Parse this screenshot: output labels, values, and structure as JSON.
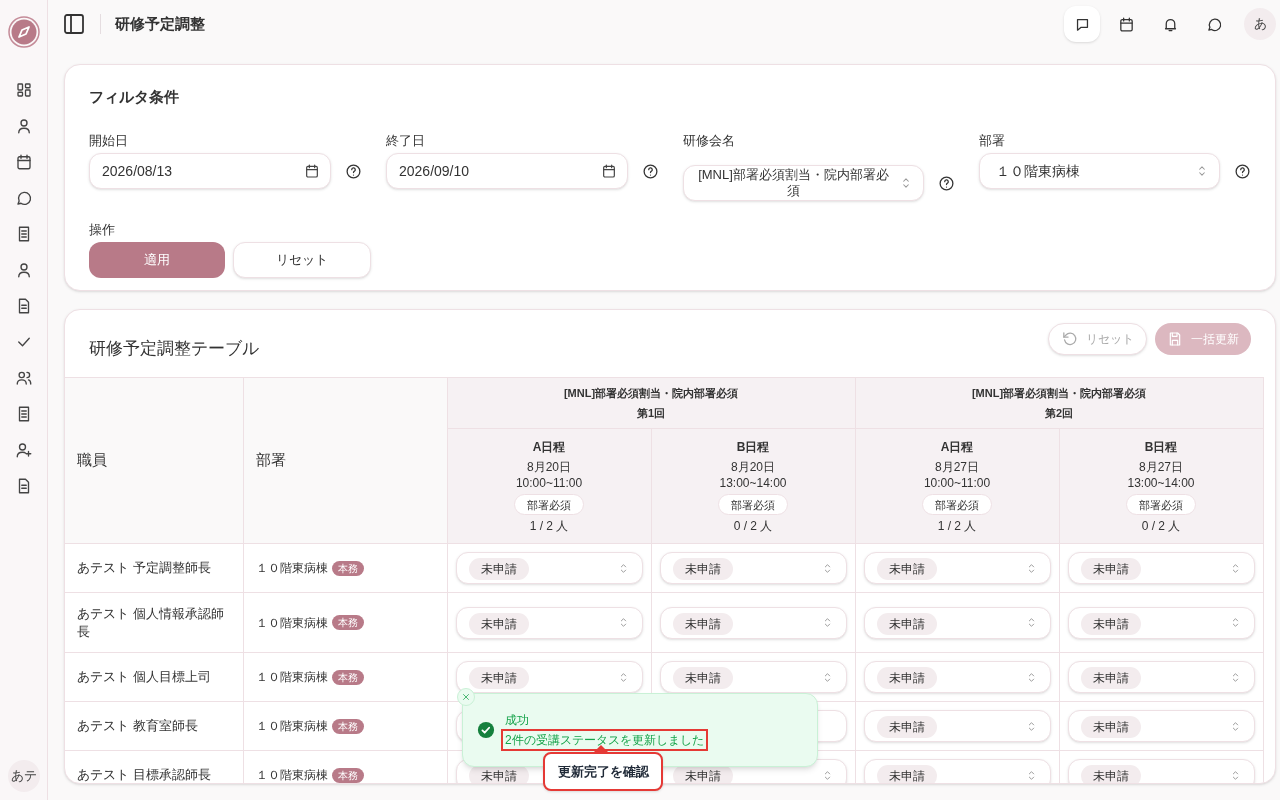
{
  "header": {
    "title": "研修予定調整",
    "avatar": "あ"
  },
  "sidebar": {
    "avatar": "あテ"
  },
  "filter": {
    "title": "フィルタ条件",
    "fields": [
      {
        "kind": "date",
        "label": "開始日",
        "value": "2026/08/13"
      },
      {
        "kind": "date",
        "label": "終了日",
        "value": "2026/09/10"
      },
      {
        "kind": "select",
        "label": "研修会名",
        "value": "[MNL]部署必須割当・院内部署必須"
      },
      {
        "kind": "select",
        "label": "部署",
        "value": "１０階東病棟"
      }
    ],
    "actions_label": "操作",
    "buttons": [
      {
        "kind": "primary",
        "label": "適用"
      },
      {
        "kind": "secondary",
        "label": "リセット"
      }
    ]
  },
  "schedule": {
    "title": "研修予定調整テーブル",
    "buttons": [
      {
        "kind": "reset",
        "label": "リセット",
        "disabled": true
      },
      {
        "kind": "save",
        "label": "一括更新",
        "disabled": true
      }
    ],
    "columns": [
      "職員",
      "部署"
    ],
    "sessions": [
      {
        "name": "[MNL]部署必須割当・院内部署必須",
        "round": "第1回",
        "slots": [
          {
            "label": "A日程",
            "date": "8月20日",
            "time": "10:00~11:00",
            "tag": "部署必須",
            "count": "1 / 2 人"
          },
          {
            "label": "B日程",
            "date": "8月20日",
            "time": "13:00~14:00",
            "tag": "部署必須",
            "count": "0 / 2 人"
          }
        ]
      },
      {
        "name": "[MNL]部署必須割当・院内部署必須",
        "round": "第2回",
        "slots": [
          {
            "label": "A日程",
            "date": "8月27日",
            "time": "10:00~11:00",
            "tag": "部署必須",
            "count": "1 / 2 人"
          },
          {
            "label": "B日程",
            "date": "8月27日",
            "time": "13:00~14:00",
            "tag": "部署必須",
            "count": "0 / 2 人"
          }
        ]
      }
    ],
    "rows": [
      {
        "name": "あテスト 予定調整師長",
        "dept": "１０階東病棟",
        "badge": "本務",
        "statuses": [
          "未申請",
          "未申請",
          "未申請",
          "未申請"
        ]
      },
      {
        "name": "あテスト 個人情報承認師長",
        "dept": "１０階東病棟",
        "badge": "本務",
        "statuses": [
          "未申請",
          "未申請",
          "未申請",
          "未申請"
        ]
      },
      {
        "name": "あテスト 個人目標上司",
        "dept": "１０階東病棟",
        "badge": "本務",
        "statuses": [
          "未申請",
          "未申請",
          "未申請",
          "未申請"
        ]
      },
      {
        "name": "あテスト 教育室師長",
        "dept": "１０階東病棟",
        "badge": "本務",
        "statuses": [
          {
            "kind": "covered"
          },
          {
            "kind": "covered"
          },
          "未申請",
          "未申請"
        ]
      },
      {
        "name": "あテスト 目標承認師長",
        "dept": "１０階東病棟",
        "badge": "本務",
        "statuses": [
          {
            "kind": "partly_covered",
            "status": "未申請"
          },
          "未申請",
          "未申請",
          "未申請"
        ]
      }
    ]
  },
  "toast": {
    "title": "成功",
    "message": "2件の受講ステータスを更新しました"
  },
  "tooltip": {
    "text": "更新完了を確認"
  }
}
